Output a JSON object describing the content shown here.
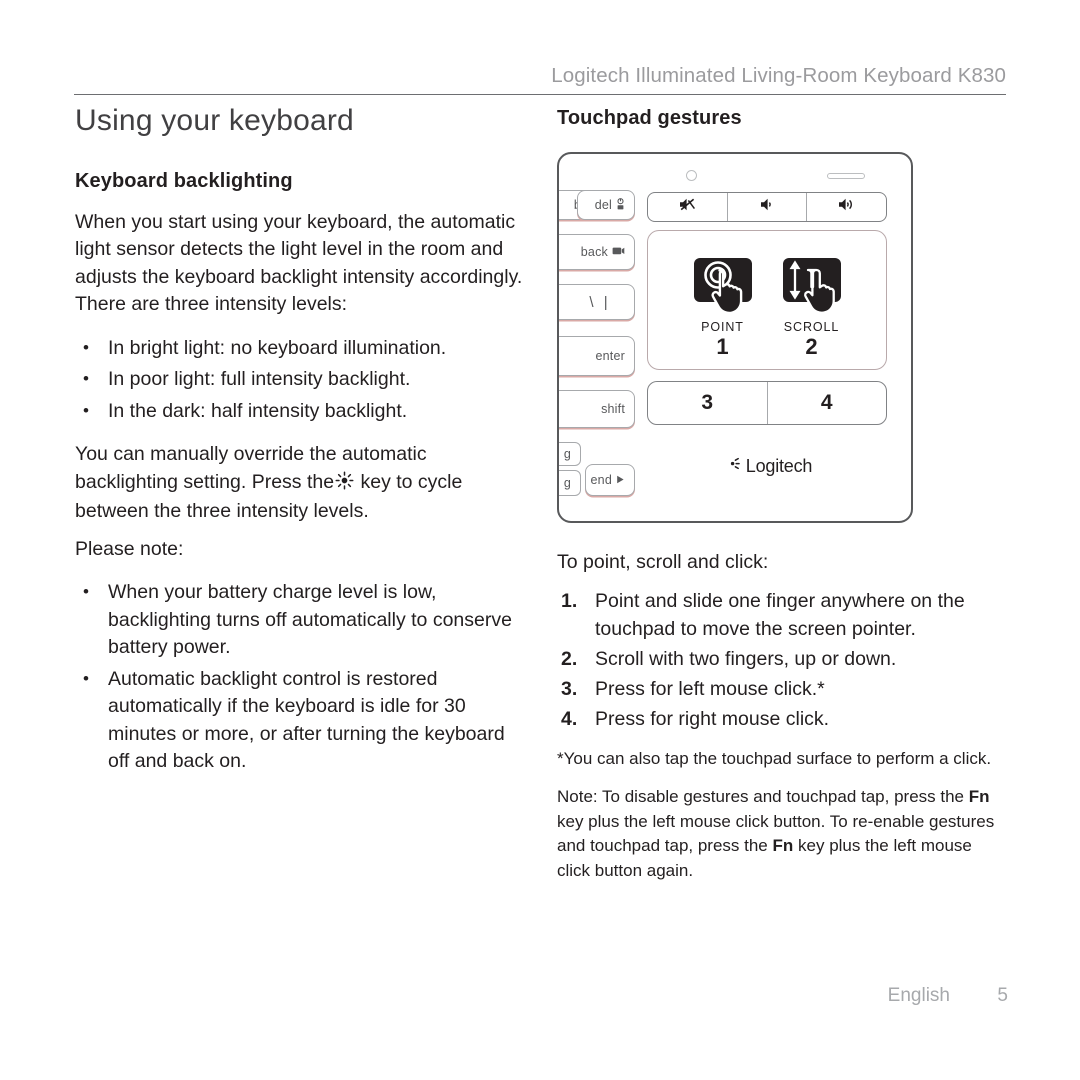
{
  "header": {
    "title": "Logitech Illuminated Living-Room Keyboard K830"
  },
  "left": {
    "page_title": "Using your keyboard",
    "section_title": "Keyboard backlighting",
    "intro_paragraph": "When you start using your keyboard, the automatic light sensor detects the light level in the room and adjusts the keyboard backlight intensity accordingly. There are three intensity levels:",
    "intensity_bullets": [
      "In bright light: no keyboard illumination.",
      "In poor light: full intensity backlight.",
      "In the dark: half intensity backlight."
    ],
    "override_text_before": "You can manually override the automatic backlighting setting. Press the",
    "override_text_after": "key to cycle between the three intensity levels.",
    "please_note_label": "Please note:",
    "note_bullets": [
      "When your battery charge level is low, backlighting turns off automatically to conserve battery power.",
      "Automatic backlight control is restored automatically if the keyboard is idle for 30 minutes or more, or after turning the keyboard off and back on."
    ]
  },
  "right": {
    "section_title": "Touchpad gestures",
    "diagram": {
      "left_keys": [
        {
          "label": "b",
          "secondary": ""
        },
        {
          "label": "del",
          "secondary": "power-lock-icon"
        },
        {
          "label": "back",
          "secondary": "camera-icon"
        },
        {
          "label": "\\ |",
          "secondary": ""
        },
        {
          "label": "enter",
          "secondary": ""
        },
        {
          "label": "shift",
          "secondary": ""
        },
        {
          "label": "g",
          "secondary": ""
        },
        {
          "label": "g",
          "secondary": ""
        },
        {
          "label": "end",
          "secondary": "play-arrow-icon"
        }
      ],
      "media_keys": [
        "mute-icon",
        "volume-down-icon",
        "volume-up-icon"
      ],
      "indicators": [
        "led-indicator",
        "light-sensor-bar"
      ],
      "gestures": [
        {
          "icon": "point-hand-icon",
          "label": "POINT",
          "number": "1"
        },
        {
          "icon": "scroll-hand-icon",
          "label": "SCROLL",
          "number": "2"
        }
      ],
      "click_buttons": [
        "3",
        "4"
      ],
      "brand": "Logitech"
    },
    "instructions_intro": "To point, scroll and click:",
    "instructions": [
      {
        "num": "1.",
        "text": "Point and slide one finger anywhere on the touchpad to move the screen pointer."
      },
      {
        "num": "2.",
        "text": "Scroll with two fingers, up or down."
      },
      {
        "num": "3.",
        "text": "Press for left mouse click.*"
      },
      {
        "num": "4.",
        "text": "Press for right mouse click."
      }
    ],
    "footnote": "*You can also tap the touchpad surface to perform a click.",
    "note_part1": "Note: To disable gestures and touchpad tap, press the",
    "note_fn1": "Fn",
    "note_part2": "key plus the left mouse click button. To re-enable gestures and touchpad tap, press the",
    "note_fn2": "Fn",
    "note_part3": "key plus the left mouse click button again."
  },
  "footer": {
    "language": "English",
    "page_number": "5"
  },
  "colors": {
    "text": "#231f20",
    "muted": "#a7a9ac",
    "rule": "#6d6e71",
    "key_outline": "#a7a9ac",
    "tile_fill": "#231f20"
  }
}
